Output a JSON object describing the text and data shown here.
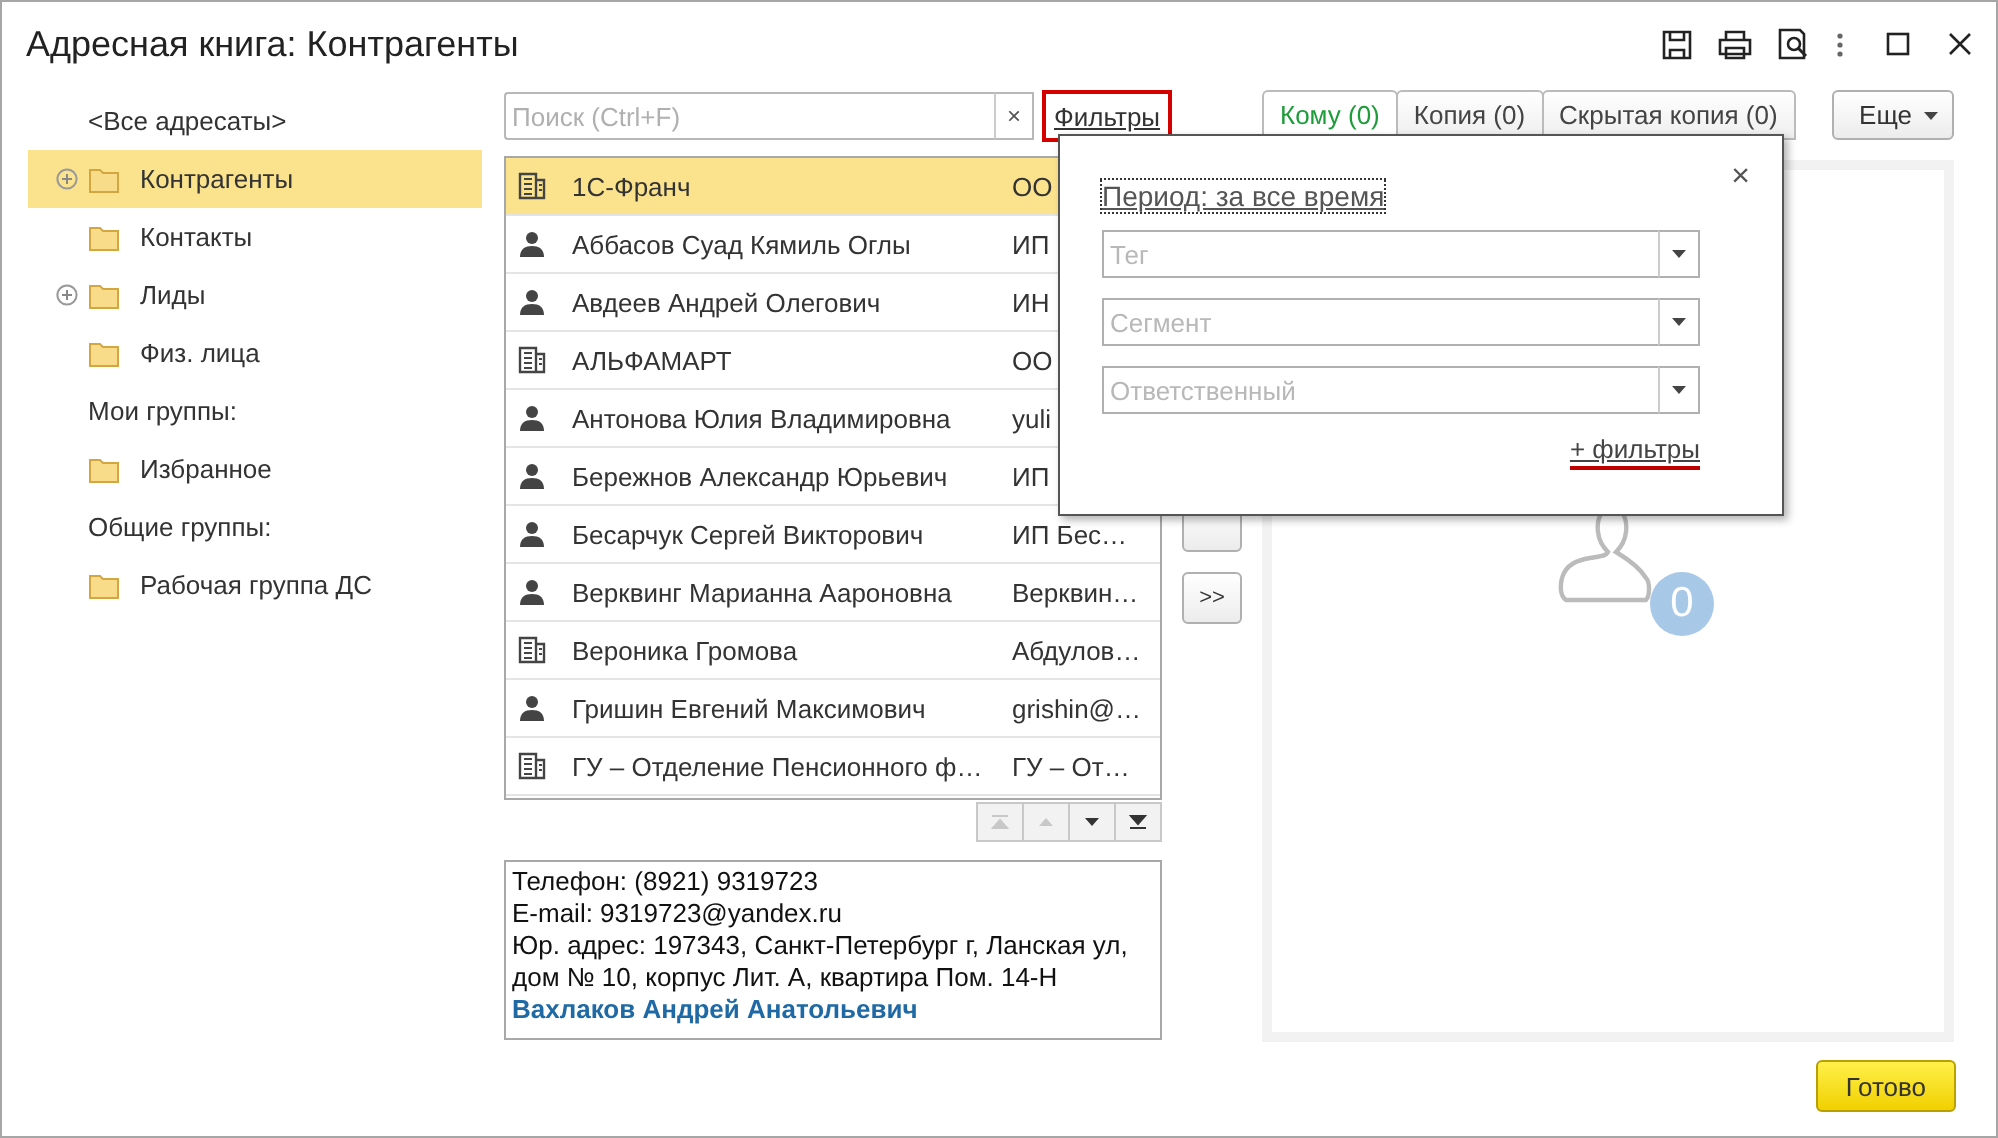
{
  "window": {
    "title": "Адресная книга: Контрагенты"
  },
  "sidebar": {
    "items": [
      {
        "kind": "all",
        "label": "<Все адресаты>",
        "selected": false
      },
      {
        "kind": "folder",
        "label": "Контрагенты",
        "selected": true,
        "expandable": true
      },
      {
        "kind": "folder",
        "label": "Контакты",
        "selected": false,
        "expandable": false
      },
      {
        "kind": "folder",
        "label": "Лиды",
        "selected": false,
        "expandable": true
      },
      {
        "kind": "folder",
        "label": "Физ. лица",
        "selected": false,
        "expandable": false
      },
      {
        "kind": "heading",
        "label": "Мои группы:"
      },
      {
        "kind": "folder",
        "label": "Избранное",
        "selected": false,
        "expandable": false
      },
      {
        "kind": "heading",
        "label": "Общие группы:"
      },
      {
        "kind": "folder",
        "label": "Рабочая группа ДС",
        "selected": false,
        "expandable": false
      }
    ]
  },
  "search": {
    "placeholder": "Поиск (Ctrl+F)",
    "clear": "×"
  },
  "filters_link": {
    "label": "Фильтры"
  },
  "list": {
    "rows": [
      {
        "kind": "org",
        "name": "1С-Франч",
        "column_2": "ОО",
        "selected": true
      },
      {
        "kind": "person",
        "name": "Аббасов Суад Кямиль Оглы",
        "column_2": "ИП",
        "selected": false
      },
      {
        "kind": "person",
        "name": "Авдеев Андрей Олегович",
        "column_2": "ИН",
        "selected": false
      },
      {
        "kind": "org",
        "name": "АЛЬФАМАРТ",
        "column_2": "ОО",
        "selected": false
      },
      {
        "kind": "person",
        "name": "Антонова Юлия Владимировна",
        "column_2": "yuli",
        "selected": false
      },
      {
        "kind": "person",
        "name": "Бережнов Александр Юрьевич",
        "column_2": "ИП",
        "selected": false
      },
      {
        "kind": "person",
        "name": "Бесарчук Сергей Викторович",
        "column_2": "ИП Бес…",
        "selected": false
      },
      {
        "kind": "person",
        "name": "Верквинг Марианна Аароновна",
        "column_2": "Верквин…",
        "selected": false
      },
      {
        "kind": "org",
        "name": "Вероника Громова",
        "column_2": "Абдулов…",
        "selected": false
      },
      {
        "kind": "person",
        "name": "Гришин Евгений Максимович",
        "column_2": "grishin@…",
        "selected": false
      },
      {
        "kind": "org",
        "name": "ГУ – Отделение Пенсионного ф…",
        "column_2": "ГУ – От…",
        "selected": false
      }
    ]
  },
  "pager": [
    {
      "kind": "first",
      "disabled": true
    },
    {
      "kind": "prev",
      "disabled": true
    },
    {
      "kind": "next",
      "disabled": false
    },
    {
      "kind": "last",
      "disabled": false
    }
  ],
  "details": {
    "lines": [
      "Телефон: (8921) 9319723",
      "E-mail: 9319723@yandex.ru",
      "Юр. адрес: 197343, Санкт-Петербург г, Ланская ул, дом № 10, корпус Лит. А, квартира Пом. 14-Н"
    ],
    "contact": "Вахлаков Андрей Анатольевич"
  },
  "move_buttons": [
    {
      "kind": "blank"
    },
    {
      "kind": "text",
      "label": ">>"
    }
  ],
  "recipient_tabs": [
    {
      "label": "Кому (0)",
      "selected": true
    },
    {
      "label": "Копия (0)",
      "selected": false
    },
    {
      "label": "Скрытая копия (0)",
      "selected": false
    }
  ],
  "more_button": {
    "label": "Еще"
  },
  "recipients": {
    "count": "0"
  },
  "filter_popup": {
    "period": "Период: за все время",
    "close": "×",
    "fields": [
      {
        "placeholder": "Тег"
      },
      {
        "placeholder": "Сегмент"
      },
      {
        "placeholder": "Ответственный"
      }
    ],
    "more_filters": "+ фильтры"
  },
  "done_button": {
    "label": "Готово"
  }
}
